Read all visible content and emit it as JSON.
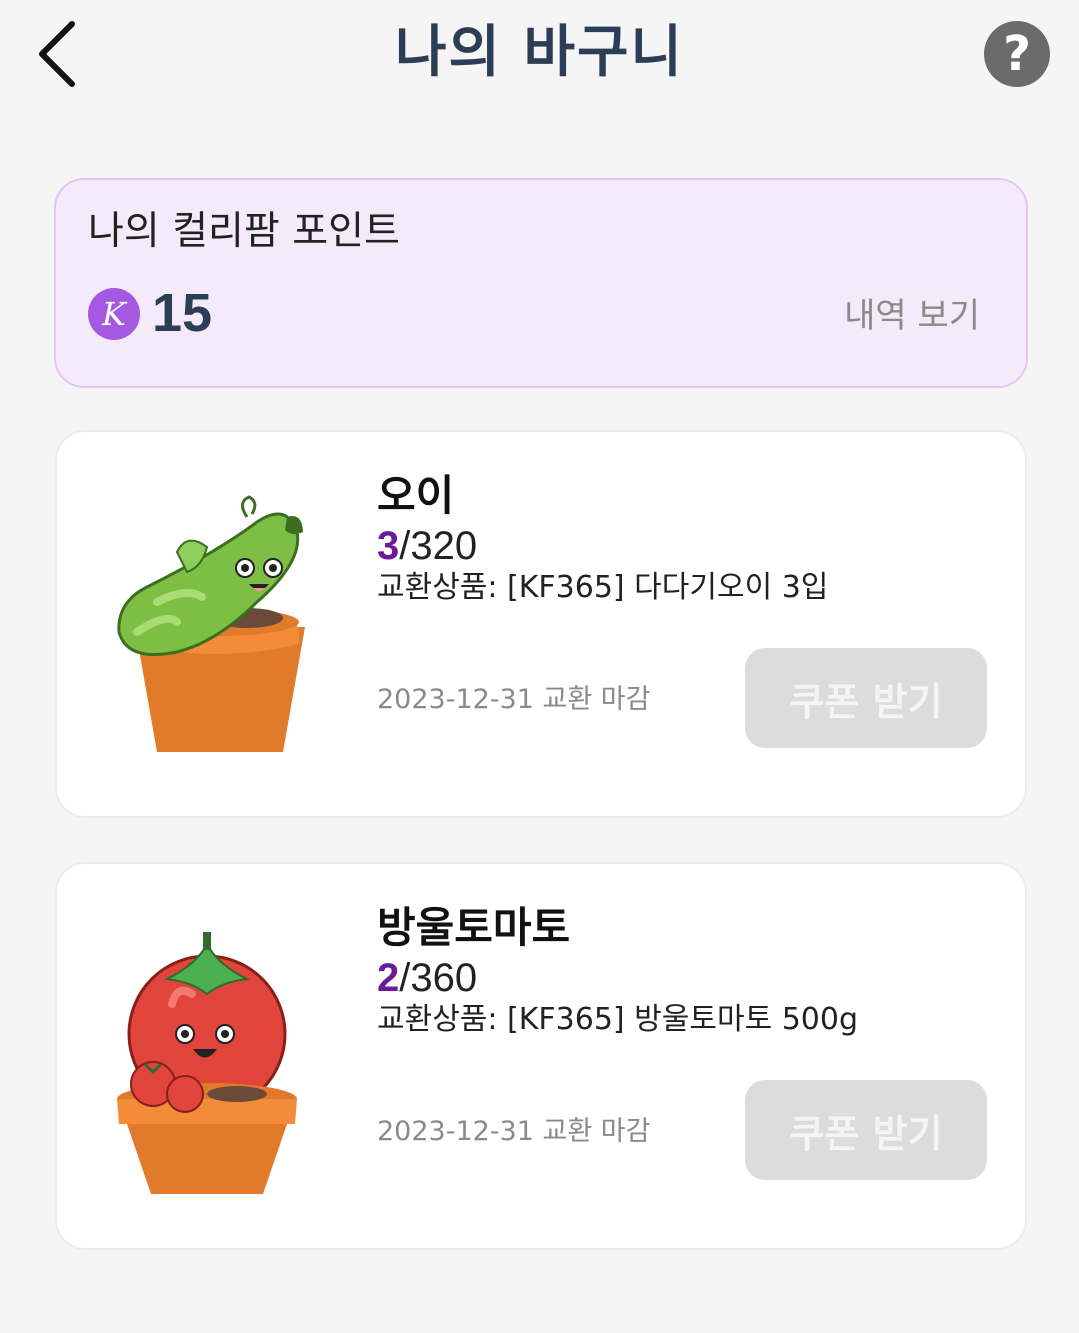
{
  "header": {
    "title": "나의 바구니",
    "help_label": "?"
  },
  "points": {
    "title": "나의 컬리팜 포인트",
    "badge_letter": "K",
    "value": "15",
    "history_label": "내역 보기"
  },
  "products": [
    {
      "name": "오이",
      "current": "3",
      "total": "/320",
      "exchange": "교환상품: [KF365] 다다기오이 3입",
      "deadline": "2023-12-31 교환 마감",
      "button_label": "쿠폰 받기"
    },
    {
      "name": "방울토마토",
      "current": "2",
      "total": "/360",
      "exchange": "교환상품: [KF365] 방울토마토 500g",
      "deadline": "2023-12-31 교환 마감",
      "button_label": "쿠폰 받기"
    }
  ],
  "colors": {
    "title": "#2c3e55",
    "accent_purple": "#6a1b9a",
    "badge": "#a35ae0",
    "points_bg": "#f4eafa",
    "button_disabled": "#dcdcdc"
  },
  "icons": {
    "back": "chevron-left-icon",
    "help": "question-icon",
    "product_1": "cucumber-pot-icon",
    "product_2": "tomato-pot-icon"
  }
}
